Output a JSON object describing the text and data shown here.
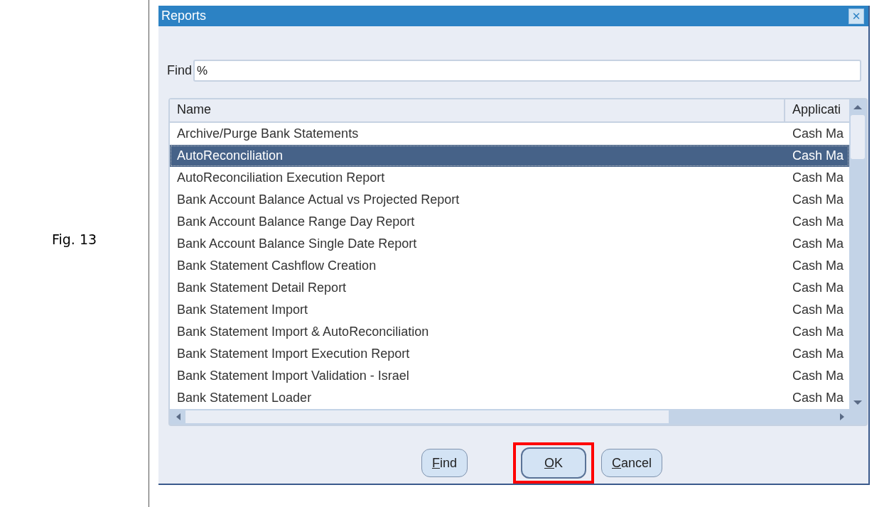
{
  "figure_label": "Fig. 13",
  "dialog": {
    "title": "Reports",
    "close": "✕"
  },
  "find": {
    "label": "Find",
    "value": "%"
  },
  "table": {
    "columns": [
      "Name",
      "Applicati"
    ],
    "rows": [
      {
        "name": "Archive/Purge Bank Statements",
        "application": "Cash Ma",
        "selected": false
      },
      {
        "name": "AutoReconciliation",
        "application": "Cash Ma",
        "selected": true
      },
      {
        "name": "AutoReconciliation Execution Report",
        "application": "Cash Ma",
        "selected": false
      },
      {
        "name": "Bank Account Balance Actual vs Projected Report",
        "application": "Cash Ma",
        "selected": false
      },
      {
        "name": "Bank Account Balance Range Day Report",
        "application": "Cash Ma",
        "selected": false
      },
      {
        "name": "Bank Account Balance Single Date Report",
        "application": "Cash Ma",
        "selected": false
      },
      {
        "name": "Bank Statement Cashflow Creation",
        "application": "Cash Ma",
        "selected": false
      },
      {
        "name": "Bank Statement Detail Report",
        "application": "Cash Ma",
        "selected": false
      },
      {
        "name": "Bank Statement Import",
        "application": "Cash Ma",
        "selected": false
      },
      {
        "name": "Bank Statement Import & AutoReconciliation",
        "application": "Cash Ma",
        "selected": false
      },
      {
        "name": "Bank Statement Import Execution Report",
        "application": "Cash Ma",
        "selected": false
      },
      {
        "name": "Bank Statement Import Validation - Israel",
        "application": "Cash Ma",
        "selected": false
      },
      {
        "name": "Bank Statement Loader",
        "application": "Cash Ma",
        "selected": false
      }
    ]
  },
  "buttons": [
    {
      "key": "F",
      "rest": "ind",
      "highlighted": false
    },
    {
      "key": "O",
      "rest": "K",
      "highlighted": true
    },
    {
      "key": "C",
      "rest": "ancel",
      "highlighted": false
    }
  ]
}
